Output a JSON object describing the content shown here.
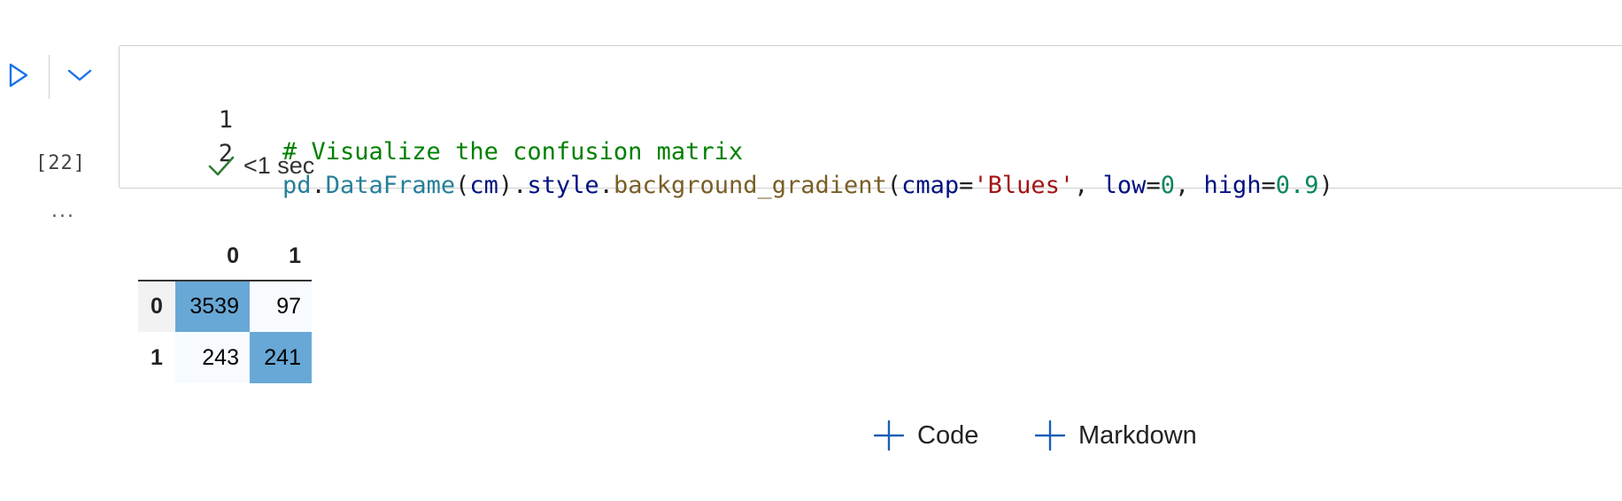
{
  "cell": {
    "execution_count": "[22]",
    "output_menu_label": "...",
    "lines": [
      {
        "number": "1",
        "tokens": [
          {
            "text": "# Visualize the confusion matrix",
            "kind": "comment"
          }
        ]
      },
      {
        "number": "2",
        "tokens": [
          {
            "text": "pd",
            "kind": "module"
          },
          {
            "text": ".",
            "kind": "plain"
          },
          {
            "text": "DataFrame",
            "kind": "module"
          },
          {
            "text": "(",
            "kind": "plain"
          },
          {
            "text": "cm",
            "kind": "var"
          },
          {
            "text": ").",
            "kind": "plain"
          },
          {
            "text": "style",
            "kind": "var"
          },
          {
            "text": ".",
            "kind": "plain"
          },
          {
            "text": "background_gradient",
            "kind": "func"
          },
          {
            "text": "(",
            "kind": "plain"
          },
          {
            "text": "cmap",
            "kind": "var"
          },
          {
            "text": "=",
            "kind": "plain"
          },
          {
            "text": "'Blues'",
            "kind": "string"
          },
          {
            "text": ", ",
            "kind": "plain"
          },
          {
            "text": "low",
            "kind": "var"
          },
          {
            "text": "=",
            "kind": "plain"
          },
          {
            "text": "0",
            "kind": "number"
          },
          {
            "text": ", ",
            "kind": "plain"
          },
          {
            "text": "high",
            "kind": "var"
          },
          {
            "text": "=",
            "kind": "plain"
          },
          {
            "text": "0.9",
            "kind": "number"
          },
          {
            "text": ")",
            "kind": "plain"
          }
        ]
      }
    ],
    "status": {
      "icon": "check-icon",
      "text": "<1 sec"
    }
  },
  "output": {
    "columns": [
      "0",
      "1"
    ],
    "rows": [
      {
        "index": "0",
        "cells": [
          {
            "value": "3539",
            "bg": "#68a8d6"
          },
          {
            "value": "97",
            "bg": "#f7fbff"
          }
        ]
      },
      {
        "index": "1",
        "cells": [
          {
            "value": "243",
            "bg": "#f7fbff"
          },
          {
            "value": "241",
            "bg": "#68a8d6"
          }
        ]
      }
    ]
  },
  "toolbar": {
    "add_code_label": "Code",
    "add_markdown_label": "Markdown"
  },
  "colors": {
    "accent": "#1a5fb4",
    "run_icon": "#1a73e8",
    "check": "#2e7d32"
  }
}
